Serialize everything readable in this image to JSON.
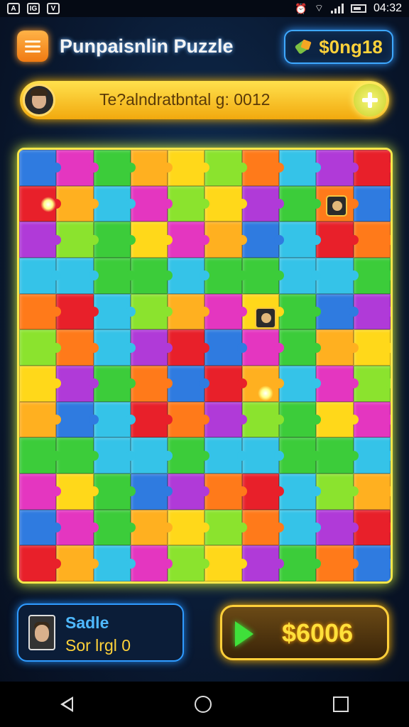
{
  "status_bar": {
    "left_icons": [
      "A",
      "IG",
      "V"
    ],
    "time": "04:32"
  },
  "header": {
    "title": "Punpaisnlin Puzzle",
    "coins": "$0ng18",
    "menu_icon": "hamburger-icon",
    "coin_icon": "coin-stack-icon"
  },
  "progress": {
    "text": "Te?alndratbntal g: 0012",
    "add_icon": "plus-icon"
  },
  "board": {
    "columns": 10,
    "rows": 12,
    "palette": [
      "#2f7be0",
      "#ffb020",
      "#ff7a1a",
      "#e8202a",
      "#3ccc3a",
      "#8be32e",
      "#b03ad8",
      "#e436c0",
      "#ffd81a",
      "#35c3e8"
    ]
  },
  "player": {
    "name": "Sadle",
    "score": "Sor lrgl 0"
  },
  "prize": {
    "value": "$6006",
    "play_icon": "play-icon"
  },
  "colors": {
    "accent_blue": "#2f9bff",
    "accent_gold": "#ffcf3a",
    "board_border": "#f7e64a"
  }
}
